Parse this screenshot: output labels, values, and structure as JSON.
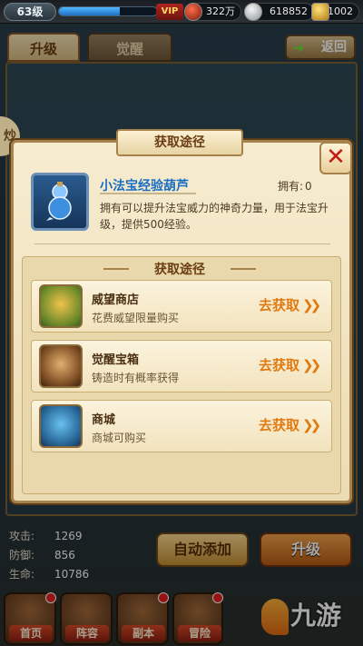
{
  "topbar": {
    "level": "63级",
    "exp_progress": 0.62,
    "vip_label": "VIP",
    "silver": "322万",
    "coins": "618852",
    "gold": "1002"
  },
  "tabs": [
    {
      "label": "升级",
      "active": true
    },
    {
      "label": "觉醒",
      "active": false
    }
  ],
  "back_label": "返回",
  "side_tab_label": "炒",
  "dialog": {
    "title": "获取途径",
    "item": {
      "name": "小法宝经验葫芦",
      "owned_label": "拥有:",
      "owned_value": "0",
      "description": "拥有可以提升法宝威力的神奇力量，用于法宝升级，提供500经验。"
    },
    "sources_title": "获取途径",
    "sources": [
      {
        "name": "威望商店",
        "desc": "花费威望限量购买",
        "action": "去获取",
        "icon": "prestige-shop-icon"
      },
      {
        "name": "觉醒宝箱",
        "desc": "铸造时有概率获得",
        "action": "去获取",
        "icon": "awaken-chest-icon"
      },
      {
        "name": "商城",
        "desc": "商城可购买",
        "action": "去获取",
        "icon": "mall-icon"
      }
    ]
  },
  "stats": [
    {
      "label": "攻击:",
      "value": "1269"
    },
    {
      "label": "防御:",
      "value": "856"
    },
    {
      "label": "生命:",
      "value": "10786"
    }
  ],
  "buttons": {
    "auto_add": "自动添加",
    "upgrade": "升级"
  },
  "bottom_nav": [
    {
      "label": "首页",
      "badge": true
    },
    {
      "label": "阵容",
      "badge": false
    },
    {
      "label": "副本",
      "badge": true
    },
    {
      "label": "冒险",
      "badge": true
    }
  ],
  "watermark": "九游",
  "colors": {
    "accent_link": "#1a6ec4",
    "action_orange": "#e07a10",
    "close_red": "#c41a12"
  }
}
